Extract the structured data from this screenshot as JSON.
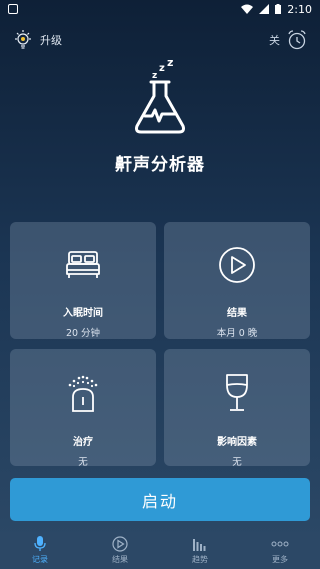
{
  "status_bar": {
    "time": "2:10"
  },
  "header": {
    "upgrade_label": "升级",
    "alarm_label": "关"
  },
  "app": {
    "title": "鼾声分析器"
  },
  "cards": [
    {
      "label": "入眠时间",
      "value": "20 分钟",
      "icon": "bed-icon"
    },
    {
      "label": "结果",
      "value": "本月 0 晚",
      "icon": "play-icon"
    },
    {
      "label": "治疗",
      "value": "无",
      "icon": "sleep-device-icon"
    },
    {
      "label": "影响因素",
      "value": "无",
      "icon": "wine-glass-icon"
    }
  ],
  "start_button": {
    "label": "启动"
  },
  "nav": [
    {
      "label": "记录",
      "icon": "microphone-icon",
      "active": true
    },
    {
      "label": "结果",
      "icon": "play-icon",
      "active": false
    },
    {
      "label": "趋势",
      "icon": "bar-chart-icon",
      "active": false
    },
    {
      "label": "更多",
      "icon": "more-icon",
      "active": false
    }
  ],
  "colors": {
    "accent": "#2f9ad6",
    "active_nav": "#4eb2ff",
    "nav_bg": "#2c4866"
  }
}
